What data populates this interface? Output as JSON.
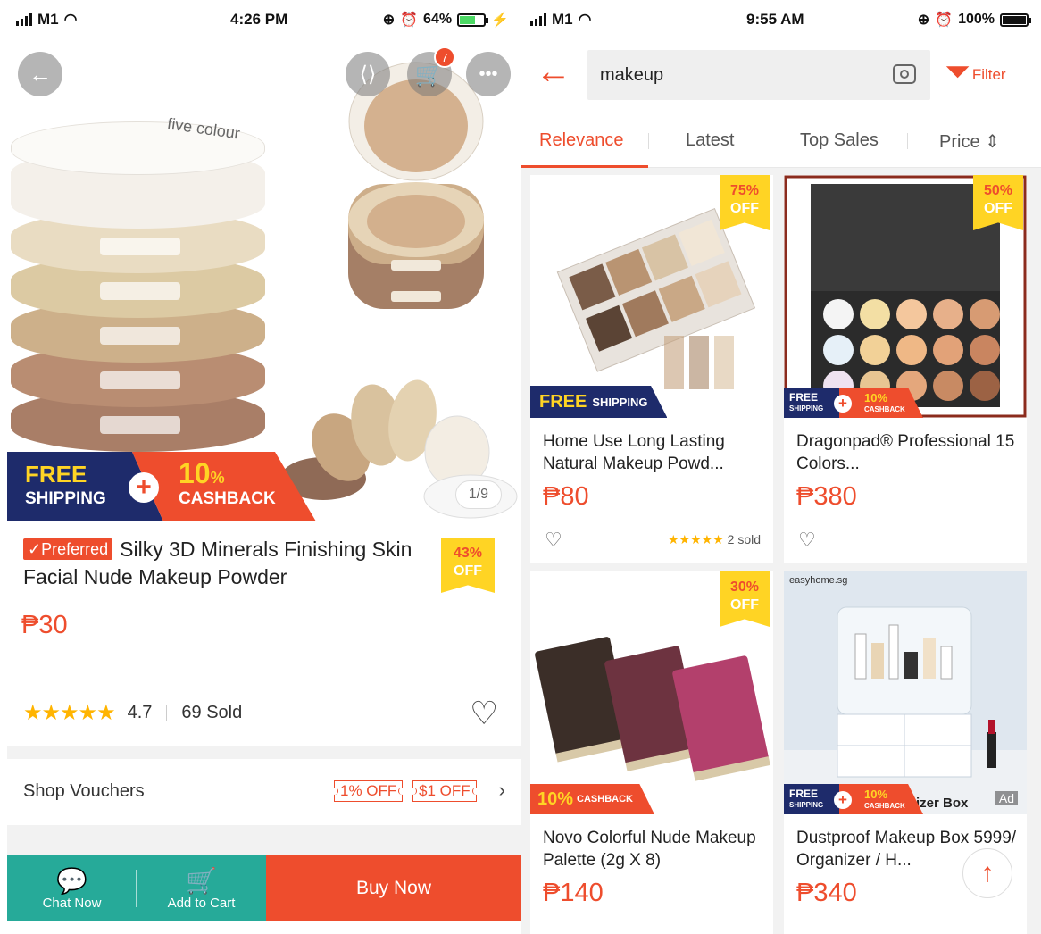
{
  "left": {
    "status": {
      "carrier": "M1",
      "time": "4:26 PM",
      "battery": "64%",
      "battery_level": 0.64
    },
    "cart_count": "7",
    "brand_text": "five colour",
    "image_counter": "1/9",
    "promo": {
      "free": "FREE",
      "shipping": "SHIPPING",
      "cashback_pct": "10",
      "cashback_pct_sign": "%",
      "cashback": "CASHBACK"
    },
    "product": {
      "preferred_label": "Preferred",
      "title": "Silky 3D Minerals Finishing Skin Facial Nude Makeup Powder",
      "discount_pct": "43%",
      "discount_off": "OFF",
      "price": "₱30",
      "stars": "★★★★★",
      "rating": "4.7",
      "sold": "69 Sold"
    },
    "vouchers": {
      "label": "Shop Vouchers",
      "tags": [
        "1% OFF",
        "$1 OFF"
      ]
    },
    "bottom_bar": {
      "chat_label": "Chat Now",
      "cart_label": "Add to Cart",
      "buy_label": "Buy Now"
    }
  },
  "right": {
    "status": {
      "carrier": "M1",
      "time": "9:55 AM",
      "battery": "100%",
      "battery_level": 1.0
    },
    "search": {
      "query": "makeup",
      "filter_label": "Filter"
    },
    "tabs": [
      "Relevance",
      "Latest",
      "Top Sales",
      "Price ⇕"
    ],
    "products": [
      {
        "name": "Home Use Long Lasting Natural Makeup Powd...",
        "price": "₱80",
        "discount_pct": "75%",
        "discount_off": "OFF",
        "badge_big": "FREE",
        "badge_small": "SHIPPING",
        "stars": "★★★★★",
        "sold": "2 sold"
      },
      {
        "name": "Dragonpad® Professional 15 Colors...",
        "price": "₱380",
        "discount_pct": "50%",
        "discount_off": "OFF",
        "combo_free": "FREE",
        "combo_shipping": "SHIPPING",
        "combo_pct": "10%",
        "combo_cashback": "CASHBACK"
      },
      {
        "name": "Novo Colorful Nude Makeup Palette (2g X 8)",
        "price": "₱140",
        "discount_pct": "30%",
        "discount_off": "OFF",
        "cashback_big": "10%",
        "cashback_small": "CASHBACK"
      },
      {
        "name": "Dustproof Makeup Box 5999/ Organizer / H...",
        "price": "₱340",
        "combo_free": "FREE",
        "combo_shipping": "SHIPPING",
        "combo_pct": "10%",
        "combo_cashback": "CASHBACK",
        "img_brand": "easyhome.sg",
        "img_caption": "izer Box",
        "ad": "Ad"
      }
    ]
  },
  "colors": {
    "accent": "#ee4d2d",
    "teal": "#26aa99",
    "flag": "#ffd424",
    "navy": "#1e2b6b",
    "star": "#ffb400"
  }
}
